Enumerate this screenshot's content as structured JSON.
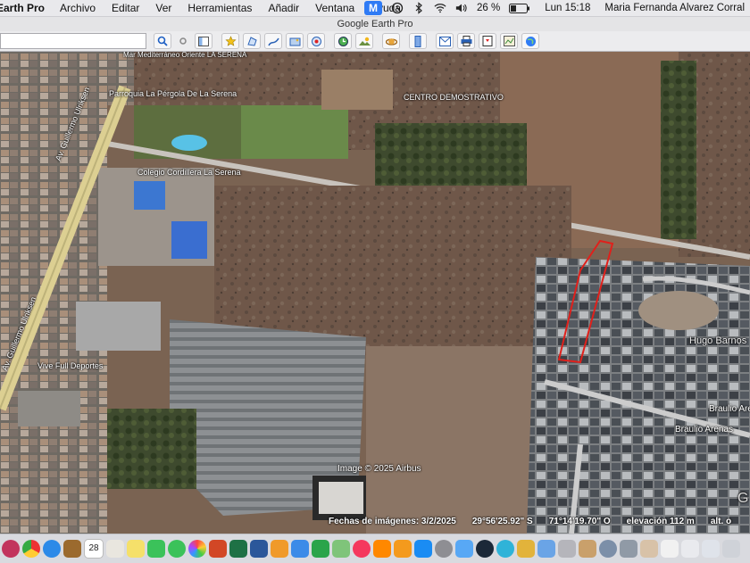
{
  "menubar": {
    "app_name": "Earth Pro",
    "items": [
      "Archivo",
      "Editar",
      "Ver",
      "Herramientas",
      "Añadir",
      "Ventana",
      "Ayuda"
    ],
    "battery": "26 %",
    "clock": "Lun 15:18",
    "user": "Maria Fernanda Alvarez Corral",
    "badge_letter": "M"
  },
  "window": {
    "title": "Google Earth Pro"
  },
  "map": {
    "labels": {
      "street_top": "Mar Mediterráneo Oriente LA SERENA",
      "parish": "Parroquia La Pérgola De La Serena",
      "stadium": "CENTRO DEMOSTRATIVO",
      "school": "Colegio Cordillera La Serena",
      "avenue": "Av. Guillermo Ulriksen",
      "avenue2": "Av. Guillermo Ulriksen",
      "store": "Vive Full Deportes",
      "street_hugo": "Hugo Barnos",
      "street_braulio1": "Braulio Arenas",
      "street_braulio2": "Braulio Arenas",
      "copyright": "Image © 2025 Airbus",
      "brand_edge": "G"
    },
    "status": {
      "imagery_date": "Fechas de imágenes: 3/2/2025",
      "lat": "29°56'25.92\" S",
      "lon": "71°14'19.70\" O",
      "elevation": "elevación  112 m",
      "alt": "alt. o"
    },
    "colors": {
      "polygon": "#e0201b"
    }
  },
  "dock": {
    "calendar_day": "28"
  }
}
